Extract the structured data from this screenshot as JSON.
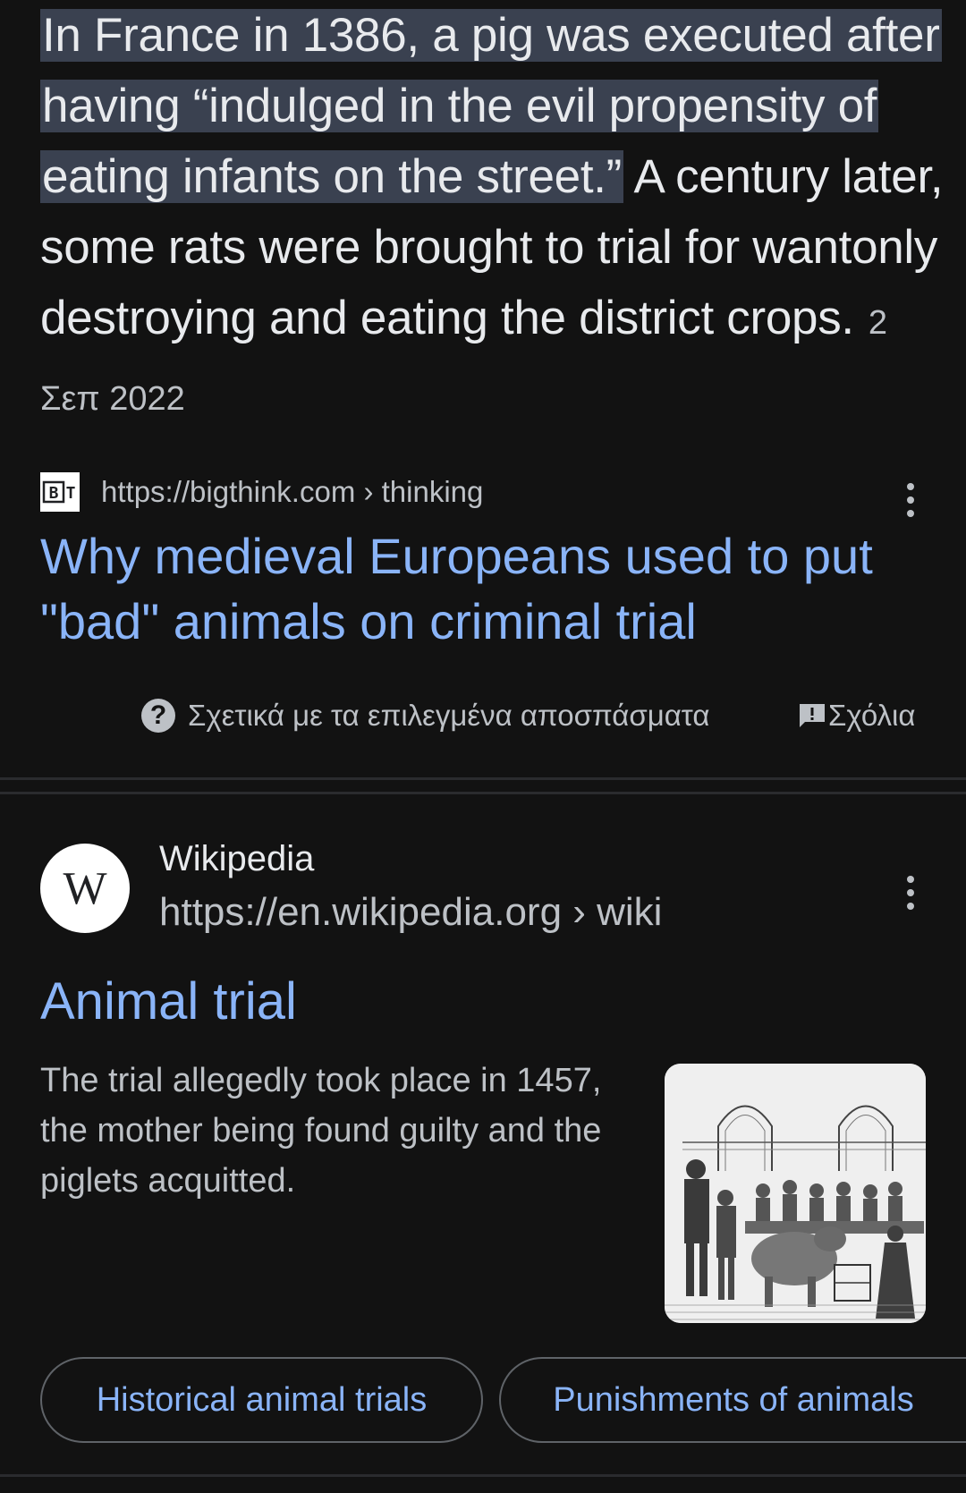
{
  "featured_snippet": {
    "highlight_text": "In France in 1386, a pig was executed after having “indulged in the evil propensity of eating infants on the street.”",
    "rest_text": " A century later, some rats were brought to trial for wantonly destroying and eating the district crops.",
    "date": "2 Σεπ 2022"
  },
  "result1": {
    "favicon_text": "BT",
    "url": "https://bigthink.com › thinking",
    "title": "Why medieval Europeans used to put \"bad\" animals on criminal trial",
    "more_icon": "more-vert-icon"
  },
  "snippet_footer": {
    "about_icon": "help-icon",
    "about_label": "Σχετικά με τα επιλεγμένα αποσπάσματα",
    "feedback_icon": "feedback-icon",
    "feedback_label": "Σχόλια"
  },
  "result2": {
    "logo_letter": "W",
    "site_name": "Wikipedia",
    "url": "https://en.wikipedia.org › wiki",
    "title": "Animal trial",
    "snippet": "The trial allegedly took place in 1457, the mother being found guilty and the piglets acquitted.",
    "more_icon": "more-vert-icon"
  },
  "chips": [
    {
      "label": "Historical animal trials"
    },
    {
      "label": "Punishments of animals"
    }
  ],
  "colors": {
    "background": "#121212",
    "link": "#8ab4f8",
    "highlight": "#3a4150",
    "text": "#e8eaed",
    "secondary_text": "#bdc1c6"
  }
}
